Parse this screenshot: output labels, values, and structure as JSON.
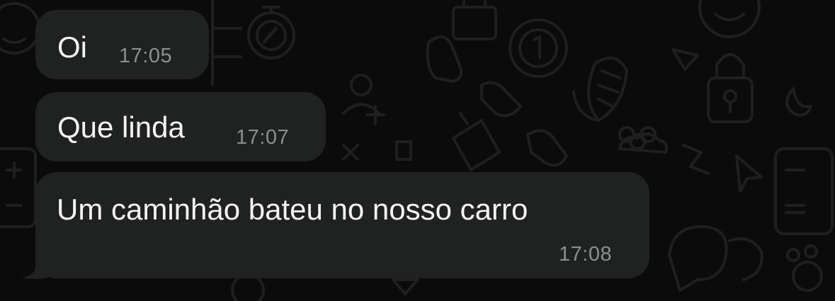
{
  "chat": {
    "messages": [
      {
        "text": "Oi",
        "time": "17:05"
      },
      {
        "text": "Que linda",
        "time": "17:07"
      },
      {
        "text": "Um caminhão bateu no nosso carro",
        "time": "17:08"
      }
    ]
  },
  "colors": {
    "background": "#0b0b0b",
    "bubble": "#202221",
    "text": "#f4f4f4",
    "timestamp": "#8d8f8e",
    "wallpaper_doodles": "#1e1e1e"
  }
}
